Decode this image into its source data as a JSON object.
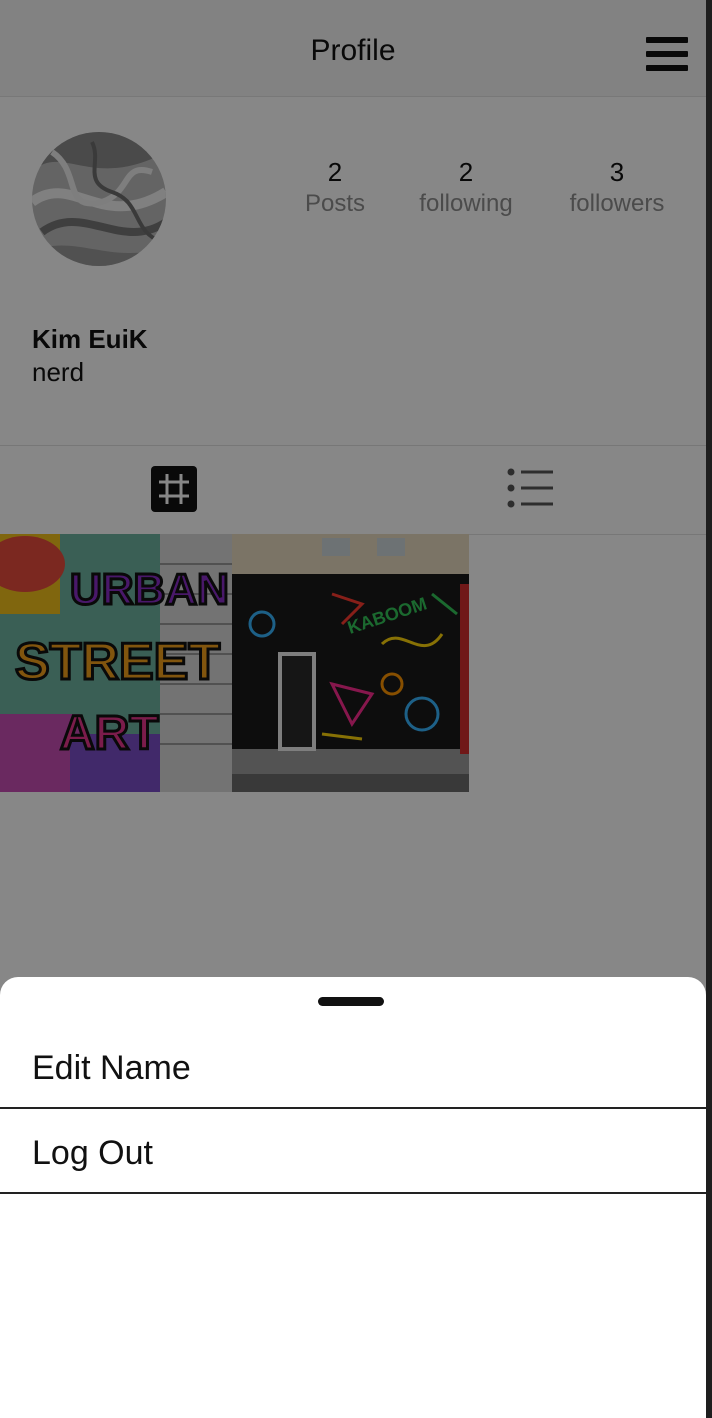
{
  "header": {
    "title": "Profile"
  },
  "profile": {
    "name": "Kim EuiK",
    "bio": "nerd",
    "stats": [
      {
        "value": "2",
        "label": "Posts"
      },
      {
        "value": "2",
        "label": "following"
      },
      {
        "value": "3",
        "label": "followers"
      }
    ]
  },
  "tabs": [
    {
      "icon": "grid-icon",
      "active": true
    },
    {
      "icon": "list-icon",
      "active": false
    }
  ],
  "posts": [
    {
      "image": "graffiti-urban-street-art"
    },
    {
      "image": "graffiti-storefront-kaboom"
    }
  ],
  "sheet": {
    "items": [
      {
        "label": "Edit Name"
      },
      {
        "label": "Log Out"
      }
    ]
  },
  "colors": {
    "overlay": "#000000",
    "sheet_background": "#ffffff",
    "muted_text": "#8e8e8e"
  }
}
